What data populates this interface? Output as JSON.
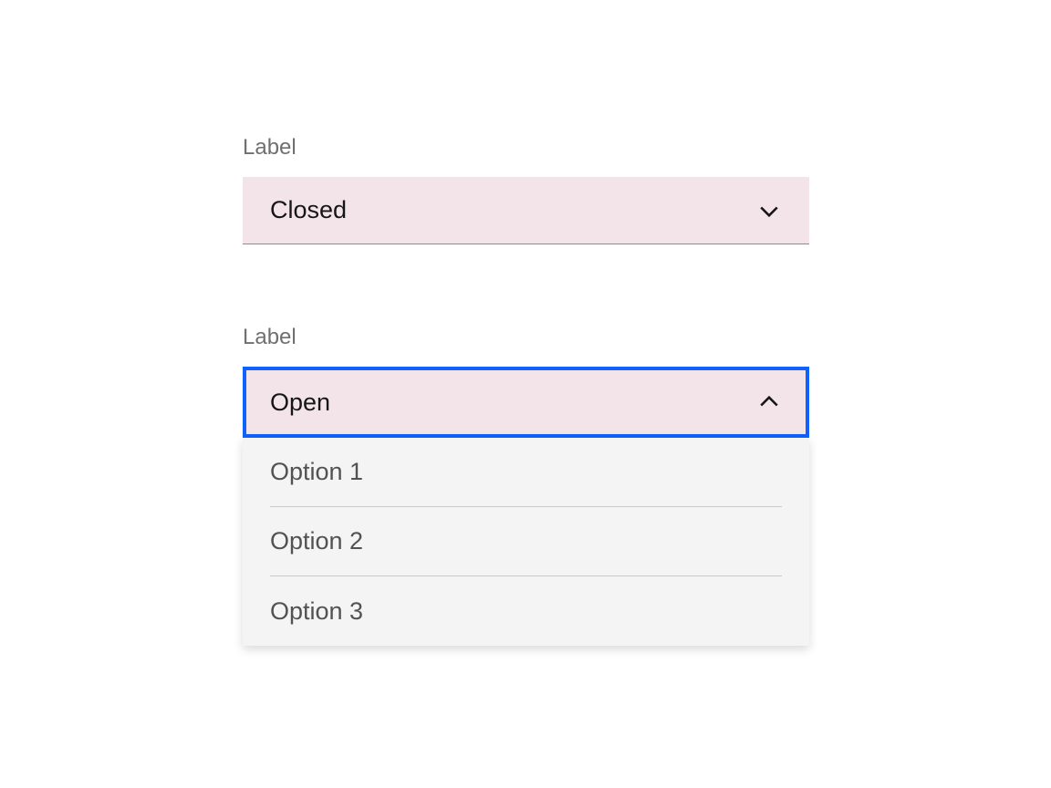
{
  "dropdown1": {
    "label": "Label",
    "value": "Closed"
  },
  "dropdown2": {
    "label": "Label",
    "value": "Open",
    "options": [
      "Option 1",
      "Option 2",
      "Option 3"
    ]
  },
  "colors": {
    "field_bg": "#f3e4e9",
    "focus_border": "#0f62fe",
    "menu_bg": "#f4f4f4",
    "label_text": "#6f6f6f",
    "value_text": "#161616",
    "option_text": "#525252"
  }
}
